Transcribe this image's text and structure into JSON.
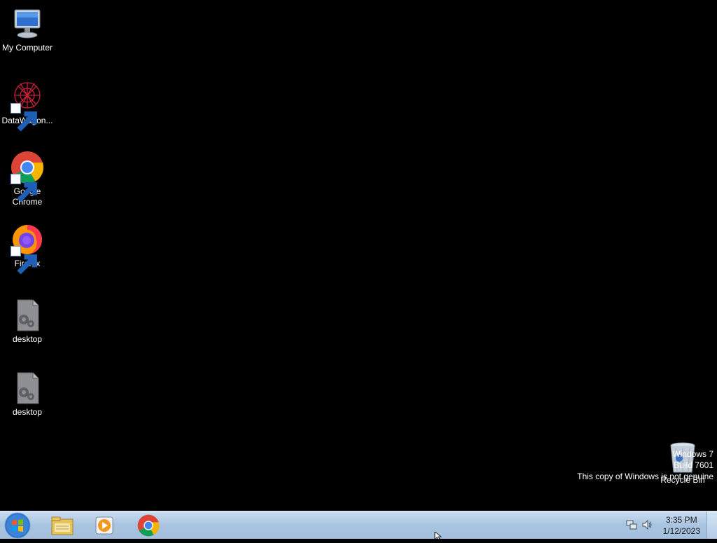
{
  "desktop_icons": [
    {
      "label": "My Computer",
      "icon": "computer-icon"
    },
    {
      "label": "DataWagon...",
      "icon": "datawagon-icon"
    },
    {
      "label": "Google Chrome",
      "icon": "chrome-icon"
    },
    {
      "label": "Firefox",
      "icon": "firefox-icon"
    },
    {
      "label": "desktop",
      "icon": "settings-file-icon"
    },
    {
      "label": "desktop",
      "icon": "settings-file-icon"
    }
  ],
  "recycle_bin": {
    "label": "Recycle Bin",
    "icon": "recycle-bin-icon"
  },
  "watermark": {
    "line1": "Windows 7",
    "line2": "Build 7601",
    "line3": "This copy of Windows is not genuine"
  },
  "taskbar": {
    "pinned": [
      "windows-explorer-icon",
      "media-player-icon",
      "chrome-icon"
    ],
    "clock_time": "3:35 PM",
    "clock_date": "1/12/2023"
  },
  "colors": {
    "desktop_bg": "#000000",
    "taskbar": "#a9c4e0"
  }
}
